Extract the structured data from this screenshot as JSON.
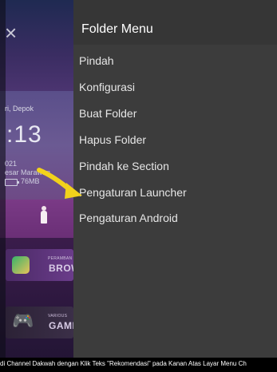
{
  "background": {
    "location": "ri, Depok",
    "time": ":13",
    "year": "021",
    "prayer": "esar Marawan",
    "storage": "76MB",
    "banner_brow": {
      "small": "PERAMBAN",
      "big": "BROW"
    },
    "banner_game": {
      "small": "VARIOUS",
      "big": "GAMI"
    }
  },
  "drawer": {
    "title": "Folder Menu",
    "items": [
      "Pindah",
      "Konfigurasi",
      "Buat Folder",
      "Hapus Folder",
      "Pindah ke Section",
      "Pengaturan Launcher",
      "Pengaturan Android"
    ]
  },
  "caption": "di Channel Dakwah dengan Klik Teks \"Rekomendasi\" pada Kanan Atas Layar Menu Ch",
  "colors": {
    "drawer_bg": "#3c3c3c",
    "arrow": "#f2d21b"
  }
}
